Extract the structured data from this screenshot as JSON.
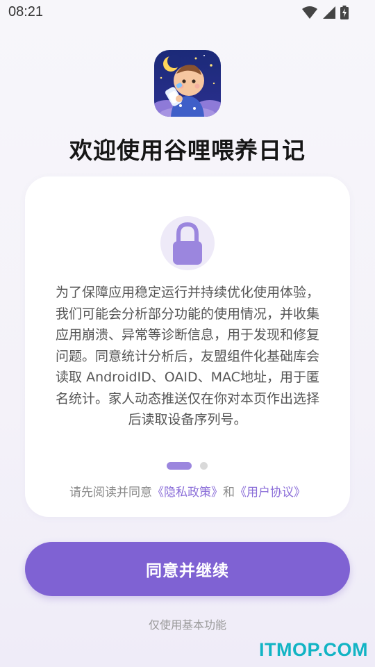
{
  "status_bar": {
    "time": "08:21",
    "icons": [
      "wifi-icon",
      "cellular-signal-icon",
      "battery-charging-icon"
    ]
  },
  "app": {
    "icon": "baby-with-bottle-app-icon",
    "title": "欢迎使用谷哩喂养日记"
  },
  "card": {
    "icon": "lock-icon",
    "body": "为了保障应用稳定运行并持续优化使用体验，我们可能会分析部分功能的使用情况，并收集应用崩溃、异常等诊断信息，用于发现和修复问题。同意统计分析后，友盟组件化基础库会读取 AndroidID、OAID、MAC地址，用于匿名统计。家人动态推送仅在你对本页作出选择后读取设备序列号。",
    "pager": {
      "total": 2,
      "active": 1
    },
    "agreement": {
      "prefix": "请先阅读并同意",
      "privacy_link": "《隐私政策》",
      "conjunction": "和",
      "terms_link": "《用户协议》"
    }
  },
  "actions": {
    "agree_button": "同意并继续",
    "basic_only_link": "仅使用基本功能"
  },
  "watermark": "ITMOP.COM",
  "colors": {
    "accent": "#7f62d3",
    "link": "#8a6dd8",
    "watermark": "#12b4c4"
  }
}
